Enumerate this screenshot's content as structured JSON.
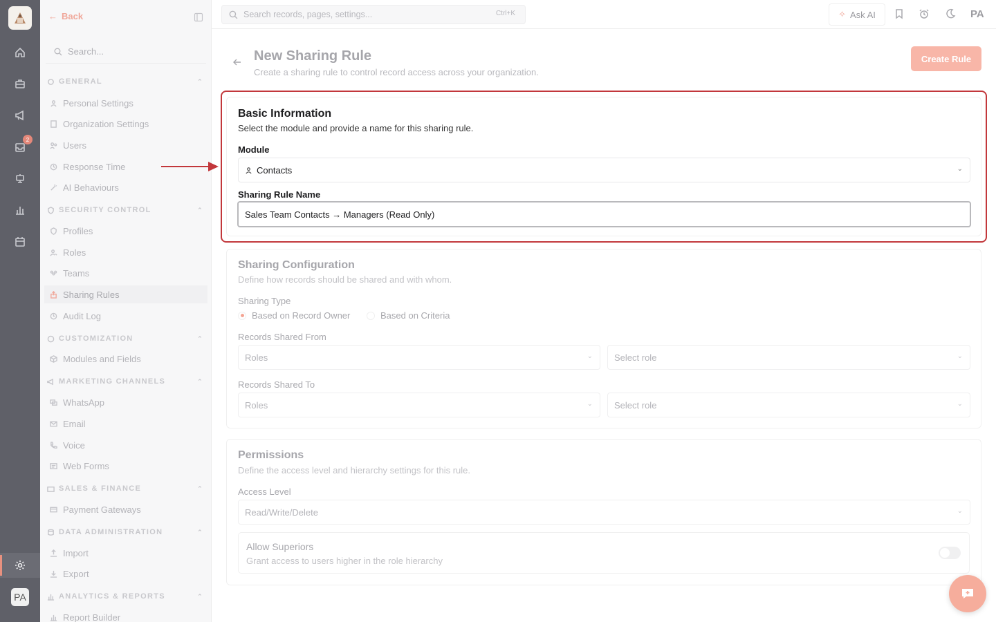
{
  "rail": {
    "notification_count": "2",
    "avatar_initials": "PA",
    "icons": [
      "home-icon",
      "briefcase-icon",
      "megaphone-icon",
      "inbox-icon",
      "robot-icon",
      "bar-chart-icon",
      "calendar-icon",
      "gear-icon"
    ]
  },
  "sidebar": {
    "back_label": "Back",
    "search_placeholder": "Search...",
    "sections": [
      {
        "title": "GENERAL",
        "items": [
          "Personal Settings",
          "Organization Settings",
          "Users",
          "Response Time",
          "AI Behaviours"
        ]
      },
      {
        "title": "SECURITY CONTROL",
        "items": [
          "Profiles",
          "Roles",
          "Teams",
          "Sharing Rules",
          "Audit Log"
        ]
      },
      {
        "title": "CUSTOMIZATION",
        "items": [
          "Modules and Fields"
        ]
      },
      {
        "title": "MARKETING CHANNELS",
        "items": [
          "WhatsApp",
          "Email",
          "Voice",
          "Web Forms"
        ]
      },
      {
        "title": "SALES & FINANCE",
        "items": [
          "Payment Gateways"
        ]
      },
      {
        "title": "DATA ADMINISTRATION",
        "items": [
          "Import",
          "Export"
        ]
      },
      {
        "title": "ANALYTICS & REPORTS",
        "items": [
          "Report Builder"
        ]
      }
    ],
    "active_item": "Sharing Rules"
  },
  "topbar": {
    "search_placeholder": "Search records, pages, settings...",
    "search_shortcut": "Ctrl+K",
    "ask_ai_label": "Ask AI",
    "user_initials": "PA"
  },
  "header": {
    "title": "New Sharing Rule",
    "subtitle": "Create a sharing rule to control record access across your organization.",
    "create_button": "Create Rule"
  },
  "basic_info": {
    "title": "Basic Information",
    "subtitle": "Select the module and provide a name for this sharing rule.",
    "module_label": "Module",
    "module_value": "Contacts",
    "name_label": "Sharing Rule Name",
    "name_value": "Sales Team Contacts → Managers (Read Only)"
  },
  "sharing_config": {
    "title": "Sharing Configuration",
    "subtitle": "Define how records should be shared and with whom.",
    "type_label": "Sharing Type",
    "type_options": [
      "Based on Record Owner",
      "Based on Criteria"
    ],
    "type_selected": "Based on Record Owner",
    "from_label": "Records Shared From",
    "from_type": "Roles",
    "from_role_placeholder": "Select role",
    "to_label": "Records Shared To",
    "to_type": "Roles",
    "to_role_placeholder": "Select role"
  },
  "permissions": {
    "title": "Permissions",
    "subtitle": "Define the access level and hierarchy settings for this rule.",
    "access_label": "Access Level",
    "access_value": "Read/Write/Delete",
    "superiors_title": "Allow Superiors",
    "superiors_desc": "Grant access to users higher in the role hierarchy",
    "superiors_enabled": false
  },
  "colors": {
    "accent": "#f8b6a8",
    "highlight_border": "#c2373b",
    "rail_bg": "#5f6068"
  }
}
